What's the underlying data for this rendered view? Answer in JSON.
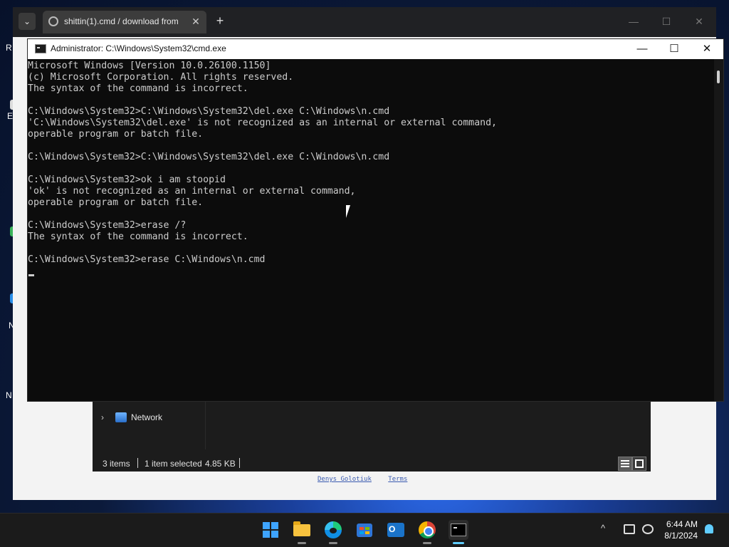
{
  "browser": {
    "tab_title": "shittin(1).cmd / download from",
    "tab_close": "✕",
    "new_tab": "+",
    "dropdown": "⌄",
    "controls": {
      "minimize": "—",
      "maximize": "☐",
      "close": "✕"
    }
  },
  "desktop": {
    "labels": [
      "R",
      "E",
      "N",
      "N"
    ]
  },
  "cmd": {
    "title": "Administrator: C:\\Windows\\System32\\cmd.exe",
    "controls": {
      "minimize": "—",
      "maximize": "☐",
      "close": "✕"
    },
    "lines": [
      "Microsoft Windows [Version 10.0.26100.1150]",
      "(c) Microsoft Corporation. All rights reserved.",
      "The syntax of the command is incorrect.",
      "",
      "C:\\Windows\\System32>C:\\Windows\\System32\\del.exe C:\\Windows\\n.cmd",
      "'C:\\Windows\\System32\\del.exe' is not recognized as an internal or external command,",
      "operable program or batch file.",
      "",
      "C:\\Windows\\System32>C:\\Windows\\System32\\del.exe C:\\Windows\\n.cmd",
      "",
      "C:\\Windows\\System32>ok i am stoopid",
      "'ok' is not recognized as an internal or external command,",
      "operable program or batch file.",
      "",
      "C:\\Windows\\System32>erase /?",
      "The syntax of the command is incorrect.",
      "",
      "C:\\Windows\\System32>erase C:\\Windows\\n.cmd"
    ]
  },
  "explorer": {
    "nav_item": "Network",
    "status": {
      "items": "3 items",
      "selected": "1 item selected",
      "size": "4.85 KB"
    }
  },
  "page_footer": {
    "links": [
      "Denys Golotiuk",
      "Terms"
    ]
  },
  "taskbar": {
    "apps": [
      "start-icon",
      "file-explorer-icon",
      "edge-icon",
      "store-icon",
      "outlook-icon",
      "chrome-icon",
      "terminal-icon"
    ],
    "tray_chevron": "^",
    "time": "6:44 AM",
    "date": "8/1/2024"
  },
  "colors": {
    "cmd_bg": "#0c0c0c",
    "cmd_fg": "#cccccc",
    "taskbar_bg": "#1b1b1b",
    "accent": "#60cdff"
  }
}
